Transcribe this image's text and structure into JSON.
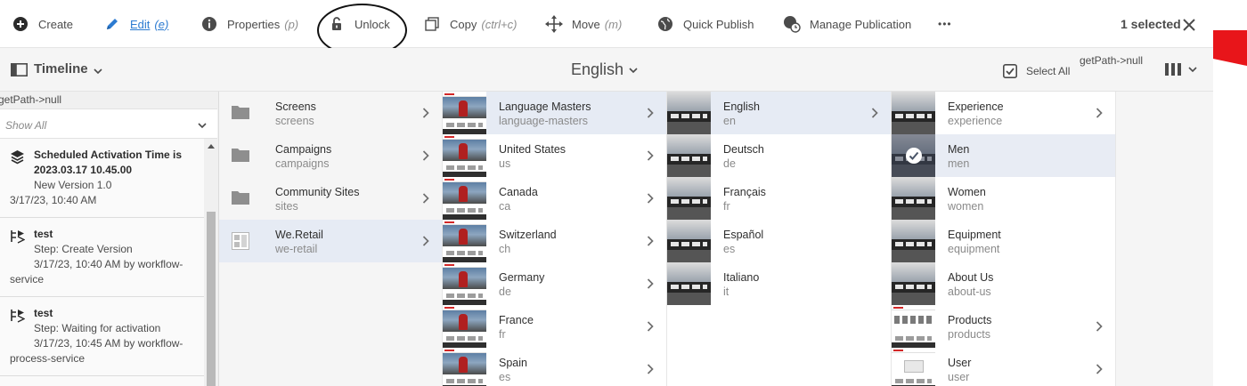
{
  "actionbar": {
    "create": "Create",
    "edit": "Edit",
    "edit_shortcut": "(e)",
    "properties": "Properties",
    "properties_shortcut": "(p)",
    "unlock": "Unlock",
    "copy": "Copy",
    "copy_shortcut": "(ctrl+c)",
    "move": "Move",
    "move_shortcut": "(m)",
    "quick_publish": "Quick Publish",
    "manage_publication": "Manage Publication",
    "more": "•••",
    "selected": "1 selected"
  },
  "subheader": {
    "rail_title": "Timeline",
    "page_heading": "English",
    "select_all": "Select All",
    "getpath": "getPath->null"
  },
  "rail": {
    "getpath": "getPath->null",
    "filter_value": "Show All",
    "items": [
      {
        "title_line1": "Scheduled Activation Time is",
        "title_line2": "2023.03.17 10.45.00",
        "detail": "New Version 1.0",
        "time": "3/17/23, 10:40 AM"
      },
      {
        "title": "test",
        "detail": "Step: Create Version",
        "meta_line1": "3/17/23, 10:40 AM by workflow-",
        "meta_line2": "service"
      },
      {
        "title": "test",
        "detail": "Step: Waiting for activation",
        "meta_line1": "3/17/23, 10:45 AM by workflow-",
        "meta_line2": "process-service"
      }
    ]
  },
  "columns": {
    "col1": [
      {
        "title": "Screens",
        "name": "screens"
      },
      {
        "title": "Campaigns",
        "name": "campaigns"
      },
      {
        "title": "Community Sites",
        "name": "sites"
      },
      {
        "title": "We.Retail",
        "name": "we-retail"
      }
    ],
    "col2": [
      {
        "title": "Language Masters",
        "name": "language-masters"
      },
      {
        "title": "United States",
        "name": "us"
      },
      {
        "title": "Canada",
        "name": "ca"
      },
      {
        "title": "Switzerland",
        "name": "ch"
      },
      {
        "title": "Germany",
        "name": "de"
      },
      {
        "title": "France",
        "name": "fr"
      },
      {
        "title": "Spain",
        "name": "es"
      }
    ],
    "col3": [
      {
        "title": "English",
        "name": "en"
      },
      {
        "title": "Deutsch",
        "name": "de"
      },
      {
        "title": "Français",
        "name": "fr"
      },
      {
        "title": "Español",
        "name": "es"
      },
      {
        "title": "Italiano",
        "name": "it"
      }
    ],
    "col4": [
      {
        "title": "Experience",
        "name": "experience"
      },
      {
        "title": "Men",
        "name": "men"
      },
      {
        "title": "Women",
        "name": "women"
      },
      {
        "title": "Equipment",
        "name": "equipment"
      },
      {
        "title": "About Us",
        "name": "about-us"
      },
      {
        "title": "Products",
        "name": "products"
      },
      {
        "title": "User",
        "name": "user"
      }
    ]
  },
  "colors": {
    "accent": "#2c7bd1",
    "selected_row": "#e6ebf4",
    "brand_red": "#e8151a"
  }
}
